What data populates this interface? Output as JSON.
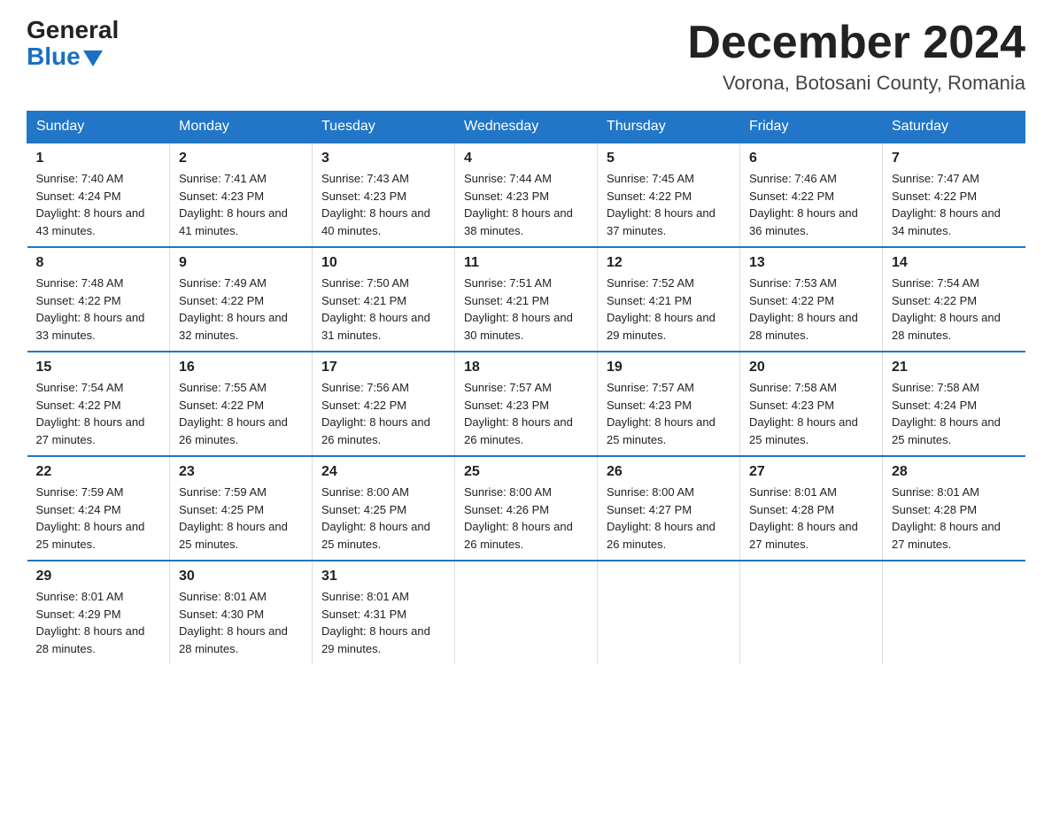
{
  "header": {
    "logo_general": "General",
    "logo_blue": "Blue",
    "month_title": "December 2024",
    "location": "Vorona, Botosani County, Romania"
  },
  "weekdays": [
    "Sunday",
    "Monday",
    "Tuesday",
    "Wednesday",
    "Thursday",
    "Friday",
    "Saturday"
  ],
  "weeks": [
    [
      {
        "day": "1",
        "sunrise": "7:40 AM",
        "sunset": "4:24 PM",
        "daylight": "8 hours and 43 minutes."
      },
      {
        "day": "2",
        "sunrise": "7:41 AM",
        "sunset": "4:23 PM",
        "daylight": "8 hours and 41 minutes."
      },
      {
        "day": "3",
        "sunrise": "7:43 AM",
        "sunset": "4:23 PM",
        "daylight": "8 hours and 40 minutes."
      },
      {
        "day": "4",
        "sunrise": "7:44 AM",
        "sunset": "4:23 PM",
        "daylight": "8 hours and 38 minutes."
      },
      {
        "day": "5",
        "sunrise": "7:45 AM",
        "sunset": "4:22 PM",
        "daylight": "8 hours and 37 minutes."
      },
      {
        "day": "6",
        "sunrise": "7:46 AM",
        "sunset": "4:22 PM",
        "daylight": "8 hours and 36 minutes."
      },
      {
        "day": "7",
        "sunrise": "7:47 AM",
        "sunset": "4:22 PM",
        "daylight": "8 hours and 34 minutes."
      }
    ],
    [
      {
        "day": "8",
        "sunrise": "7:48 AM",
        "sunset": "4:22 PM",
        "daylight": "8 hours and 33 minutes."
      },
      {
        "day": "9",
        "sunrise": "7:49 AM",
        "sunset": "4:22 PM",
        "daylight": "8 hours and 32 minutes."
      },
      {
        "day": "10",
        "sunrise": "7:50 AM",
        "sunset": "4:21 PM",
        "daylight": "8 hours and 31 minutes."
      },
      {
        "day": "11",
        "sunrise": "7:51 AM",
        "sunset": "4:21 PM",
        "daylight": "8 hours and 30 minutes."
      },
      {
        "day": "12",
        "sunrise": "7:52 AM",
        "sunset": "4:21 PM",
        "daylight": "8 hours and 29 minutes."
      },
      {
        "day": "13",
        "sunrise": "7:53 AM",
        "sunset": "4:22 PM",
        "daylight": "8 hours and 28 minutes."
      },
      {
        "day": "14",
        "sunrise": "7:54 AM",
        "sunset": "4:22 PM",
        "daylight": "8 hours and 28 minutes."
      }
    ],
    [
      {
        "day": "15",
        "sunrise": "7:54 AM",
        "sunset": "4:22 PM",
        "daylight": "8 hours and 27 minutes."
      },
      {
        "day": "16",
        "sunrise": "7:55 AM",
        "sunset": "4:22 PM",
        "daylight": "8 hours and 26 minutes."
      },
      {
        "day": "17",
        "sunrise": "7:56 AM",
        "sunset": "4:22 PM",
        "daylight": "8 hours and 26 minutes."
      },
      {
        "day": "18",
        "sunrise": "7:57 AM",
        "sunset": "4:23 PM",
        "daylight": "8 hours and 26 minutes."
      },
      {
        "day": "19",
        "sunrise": "7:57 AM",
        "sunset": "4:23 PM",
        "daylight": "8 hours and 25 minutes."
      },
      {
        "day": "20",
        "sunrise": "7:58 AM",
        "sunset": "4:23 PM",
        "daylight": "8 hours and 25 minutes."
      },
      {
        "day": "21",
        "sunrise": "7:58 AM",
        "sunset": "4:24 PM",
        "daylight": "8 hours and 25 minutes."
      }
    ],
    [
      {
        "day": "22",
        "sunrise": "7:59 AM",
        "sunset": "4:24 PM",
        "daylight": "8 hours and 25 minutes."
      },
      {
        "day": "23",
        "sunrise": "7:59 AM",
        "sunset": "4:25 PM",
        "daylight": "8 hours and 25 minutes."
      },
      {
        "day": "24",
        "sunrise": "8:00 AM",
        "sunset": "4:25 PM",
        "daylight": "8 hours and 25 minutes."
      },
      {
        "day": "25",
        "sunrise": "8:00 AM",
        "sunset": "4:26 PM",
        "daylight": "8 hours and 26 minutes."
      },
      {
        "day": "26",
        "sunrise": "8:00 AM",
        "sunset": "4:27 PM",
        "daylight": "8 hours and 26 minutes."
      },
      {
        "day": "27",
        "sunrise": "8:01 AM",
        "sunset": "4:28 PM",
        "daylight": "8 hours and 27 minutes."
      },
      {
        "day": "28",
        "sunrise": "8:01 AM",
        "sunset": "4:28 PM",
        "daylight": "8 hours and 27 minutes."
      }
    ],
    [
      {
        "day": "29",
        "sunrise": "8:01 AM",
        "sunset": "4:29 PM",
        "daylight": "8 hours and 28 minutes."
      },
      {
        "day": "30",
        "sunrise": "8:01 AM",
        "sunset": "4:30 PM",
        "daylight": "8 hours and 28 minutes."
      },
      {
        "day": "31",
        "sunrise": "8:01 AM",
        "sunset": "4:31 PM",
        "daylight": "8 hours and 29 minutes."
      },
      null,
      null,
      null,
      null
    ]
  ]
}
